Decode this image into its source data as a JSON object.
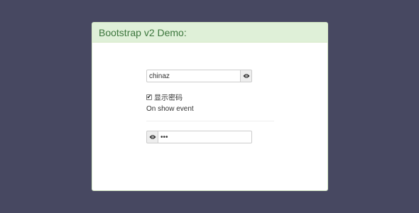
{
  "panel": {
    "title": "Bootstrap v2 Demo:"
  },
  "field1": {
    "value": "chinaz",
    "toggle_icon": "eye-icon"
  },
  "checkbox": {
    "label": "显示密码",
    "checked": true,
    "mark": "✔"
  },
  "event": {
    "text": "On show event"
  },
  "field2": {
    "value": "•••",
    "toggle_icon": "eye-icon"
  },
  "colors": {
    "background": "#474861",
    "heading_bg": "#dff0d8",
    "heading_text": "#3c763d",
    "panel_bg": "#ffffff"
  }
}
